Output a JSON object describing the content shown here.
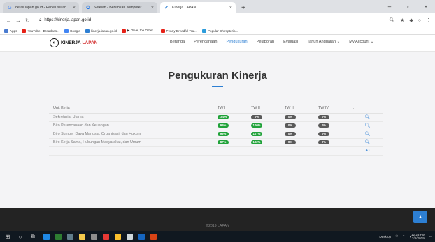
{
  "browser": {
    "tabs": [
      {
        "favicon": "G",
        "favicon_color": "#4285f4",
        "label": "detail.lapan.go.id - Penelusuran",
        "active": false
      },
      {
        "favicon": "✪",
        "favicon_color": "#1a73e8",
        "label": "Setelan - Bersihkan komputer",
        "active": false
      },
      {
        "favicon": "✔",
        "favicon_color": "#2d7fd3",
        "label": "Kinerja LAPAN",
        "active": true
      }
    ],
    "tab_close_glyph": "×",
    "new_tab_glyph": "+",
    "window_controls": [
      "–",
      "▫",
      "×"
    ],
    "url": "https://kinerja.lapan.go.id",
    "bookmarks": [
      {
        "label": "Apps",
        "color": "#4a7bd0"
      },
      {
        "label": "YouTube - Broadcas...",
        "color": "#e62117"
      },
      {
        "label": "Google",
        "color": "#4285f4"
      },
      {
        "label": "kinerja.lapan.go.id",
        "color": "#2d7fd3"
      },
      {
        "label": "▶ Olive, the Other...",
        "color": "#e62117"
      },
      {
        "label": "Penny Dreadful Trai...",
        "color": "#e62117"
      },
      {
        "label": "Popular Chiropteria...",
        "color": "#2d9cdb"
      }
    ]
  },
  "site": {
    "brand_name": "KINERJA",
    "brand_accent": "LAPAN",
    "menu": [
      {
        "label": "Beranda",
        "active": false
      },
      {
        "label": "Perencanaan",
        "active": false
      },
      {
        "label": "Pengukuran",
        "active": true
      },
      {
        "label": "Pelaporan",
        "active": false
      },
      {
        "label": "Evaluasi",
        "active": false
      },
      {
        "label": "Tahun Anggaran ⌄",
        "active": false
      },
      {
        "label": "My Account ⌄",
        "active": false
      }
    ],
    "page_title": "Pengukuran Kinerja",
    "table": {
      "headers": [
        "Unit Kerja",
        "TW I",
        "TW II",
        "TW III",
        "TW IV",
        ".."
      ],
      "rows": [
        {
          "unit": "Sekretariat Utama",
          "tw": [
            "104%",
            "0%",
            "0%",
            "0%"
          ]
        },
        {
          "unit": "Biro Perencanaan dan Keuangan",
          "tw": [
            "96%",
            "100%",
            "0%",
            "0%"
          ]
        },
        {
          "unit": "Biro Sumber Daya Manusia, Organisasi, dan Hukum",
          "tw": [
            "96%",
            "107%",
            "0%",
            "0%"
          ]
        },
        {
          "unit": "Biro Kerja Sama, Hubungan Masyarakat, dan Umum",
          "tw": [
            "87%",
            "102%",
            "0%",
            "0%"
          ]
        }
      ],
      "row_action_icon": "🔍︎",
      "back_icon": "↶"
    },
    "footer": "©2019 LAPAN",
    "to_top_icon": "▲"
  },
  "taskbar": {
    "tray_label": "Desktop",
    "time": "12:23 PM",
    "date": "7/6/2019"
  },
  "colors": {
    "accent": "#2d7fd3",
    "badge_positive": "#21a23a",
    "badge_zero": "#5a5a5a"
  }
}
